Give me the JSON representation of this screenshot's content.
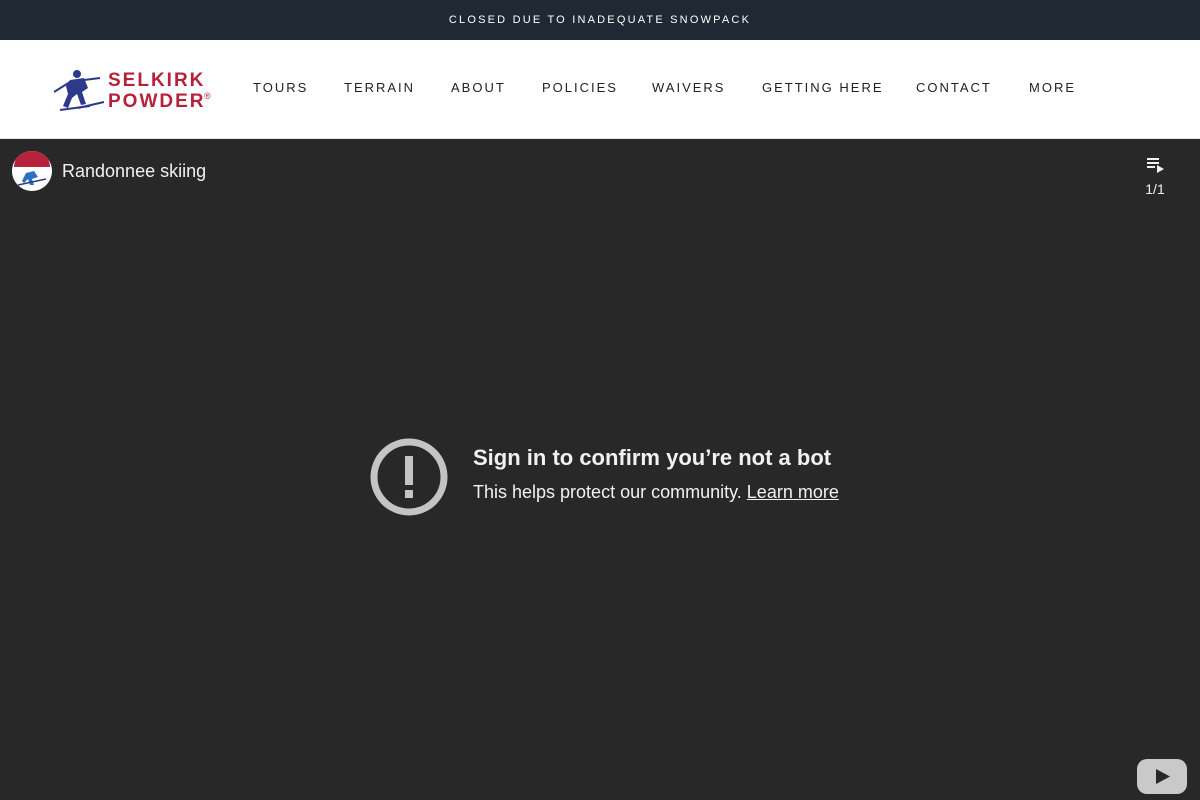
{
  "announcement": {
    "text": "CLOSED DUE TO INADEQUATE SNOWPACK"
  },
  "brand": {
    "line1": "SELKIRK",
    "line2": "POWDER",
    "registered": "®",
    "color": "#b5223a",
    "figure_color": "#2d3a8c"
  },
  "nav": {
    "items": [
      {
        "label": "TOURS"
      },
      {
        "label": "TERRAIN"
      },
      {
        "label": "ABOUT"
      },
      {
        "label": "POLICIES"
      },
      {
        "label": "WAIVERS"
      },
      {
        "label": "GETTING HERE"
      },
      {
        "label": "CONTACT"
      },
      {
        "label": "MORE"
      }
    ]
  },
  "player": {
    "video_title": "Randonnee skiing",
    "playlist_count": "1/1",
    "error_title": "Sign in to confirm you’re not a bot",
    "error_message": "This helps protect our community.",
    "learn_more": "Learn more",
    "background": "#282828",
    "icons": [
      "playlist-icon",
      "error-exclamation-icon",
      "youtube-logo-icon"
    ]
  }
}
